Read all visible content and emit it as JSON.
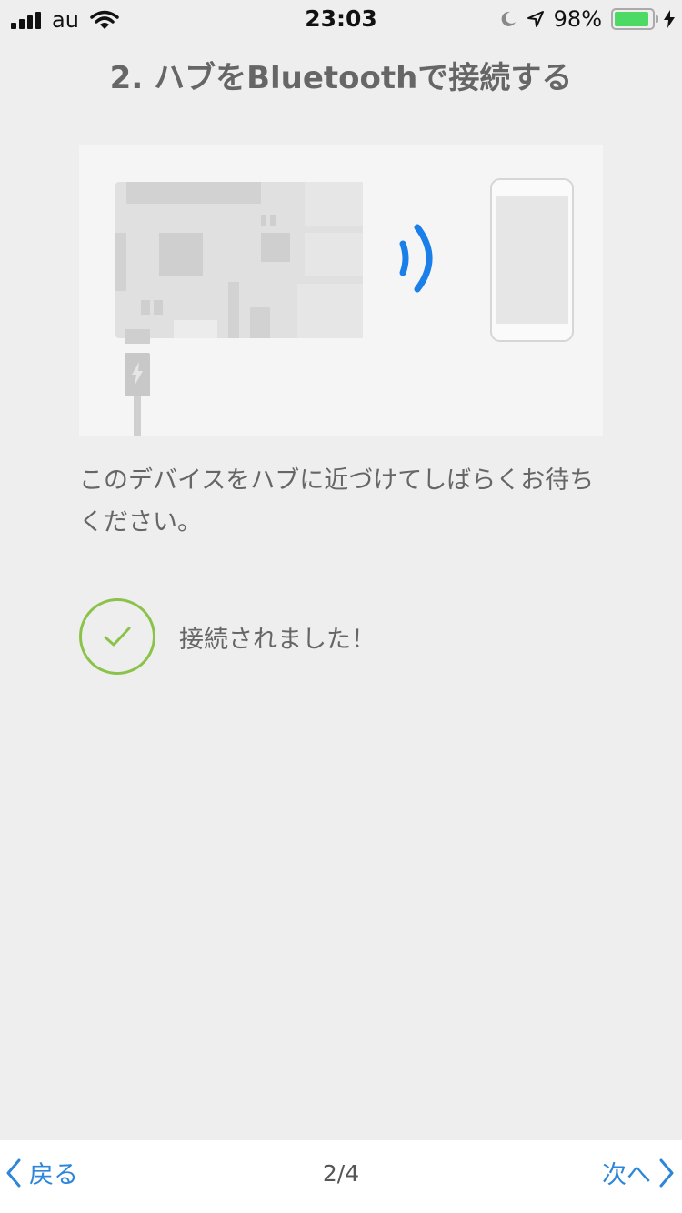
{
  "status_bar": {
    "carrier": "au",
    "time": "23:03",
    "battery_percent": "98%",
    "battery_level": 0.98
  },
  "page": {
    "title": "2. ハブをBluetoothで接続する",
    "description": "このデバイスをハブに近づけてしばらくお待ちください。",
    "connection_status": "接続されました！"
  },
  "nav": {
    "back_label": "戻る",
    "page_indicator": "2/4",
    "next_label": "次へ"
  },
  "colors": {
    "accent": "#2d86d9",
    "success": "#8bc34a",
    "signal": "#1a7fe8",
    "battery": "#4cd964"
  },
  "icons": [
    "cellular-signal-icon",
    "wifi-icon",
    "moon-icon",
    "location-arrow-icon",
    "battery-icon",
    "charging-bolt-icon",
    "bluetooth-signal-icon",
    "check-icon",
    "chevron-left-icon",
    "chevron-right-icon"
  ]
}
